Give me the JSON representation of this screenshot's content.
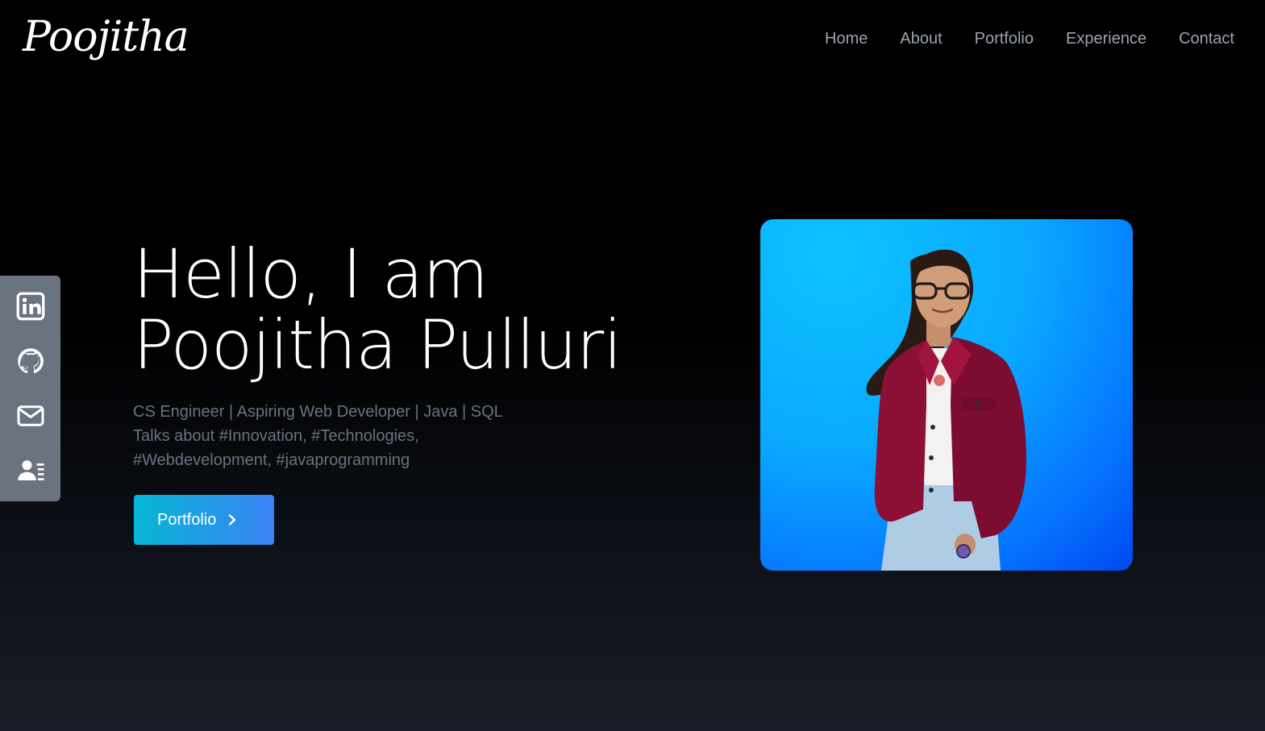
{
  "header": {
    "logo": "Poojitha",
    "nav": [
      "Home",
      "About",
      "Portfolio",
      "Experience",
      "Contact"
    ]
  },
  "social": [
    {
      "icon": "linkedin-icon"
    },
    {
      "icon": "github-icon"
    },
    {
      "icon": "mail-icon"
    },
    {
      "icon": "resume-icon"
    }
  ],
  "hero": {
    "title_line1": "Hello, I am",
    "title_line2": "Poojitha Pulluri",
    "sub_line1": "CS Engineer | Aspiring Web Developer | Java | SQL",
    "sub_line2": "Talks about #Innovation, #Technologies,",
    "sub_line3": "#Webdevelopment, #javaprogramming",
    "cta_label": "Portfolio",
    "cta_icon": "chevron-right-icon"
  },
  "colors": {
    "background": "#000000",
    "nav_text": "#9ca3af",
    "subtitle_text": "#6b7280",
    "sidebar": "#6b7280",
    "cta_start": "#06b6d4",
    "cta_end": "#3b82f6",
    "photo_bg": "#0aa9ff"
  }
}
